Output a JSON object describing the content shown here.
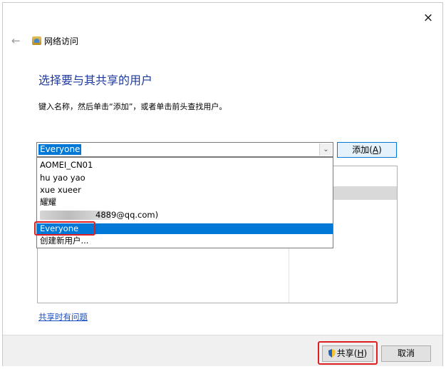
{
  "window": {
    "close_glyph": "×",
    "back_glyph": "←",
    "title": "网络访问"
  },
  "heading": "选择要与其共享的用户",
  "instruction": "键入名称，然后单击“添加”，或者单击前头查找用户。",
  "combo": {
    "value": "Everyone",
    "arrow_glyph": "⌄"
  },
  "add_button": {
    "label_prefix": "添加(",
    "hotkey": "A",
    "label_suffix": ")"
  },
  "dropdown": {
    "items": [
      "AOMEI_CN01",
      "hu yao yao",
      "xue xueer",
      "耀耀",
      "4889@qq.com)",
      "Everyone",
      "创建新用户..."
    ],
    "selected_index": 5
  },
  "problem_link": "共享时有问题",
  "footer": {
    "share_label_prefix": "共享(",
    "share_hotkey": "H",
    "share_label_suffix": ")",
    "cancel_label": "取消"
  },
  "colors": {
    "accent": "#0078d7",
    "heading": "#1e3aa0",
    "highlight": "#e02020",
    "link": "#1a4fbf"
  }
}
